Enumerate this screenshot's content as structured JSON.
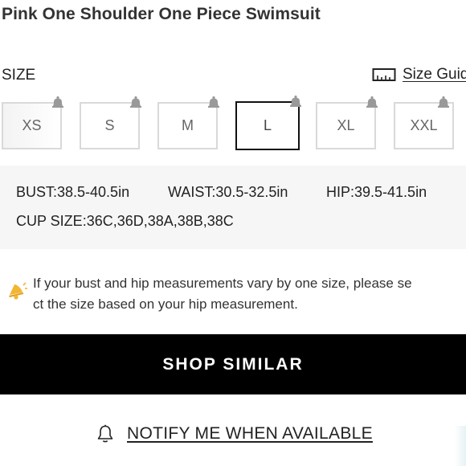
{
  "product": {
    "title": "Pink One Shoulder One Piece Swimsuit"
  },
  "size_section": {
    "label": "SIZE",
    "guide_label": "Size Guide",
    "sizes": [
      {
        "label": "XS",
        "selected": false
      },
      {
        "label": "S",
        "selected": false
      },
      {
        "label": "M",
        "selected": false
      },
      {
        "label": "L",
        "selected": true
      },
      {
        "label": "XL",
        "selected": false
      },
      {
        "label": "XXL",
        "selected": false
      }
    ]
  },
  "measurements": {
    "bust": "BUST:38.5-40.5in",
    "waist": "WAIST:30.5-32.5in",
    "hip": "HIP:39.5-41.5in",
    "cup": "CUP SIZE:36C,36D,38A,38B,38C"
  },
  "tip": {
    "icon": "speaker-bell-icon",
    "line1": "If your bust and hip measurements vary by one size, please se",
    "line2": "ct the size based on your hip measurement."
  },
  "actions": {
    "shop_similar": "SHOP SIMILAR",
    "notify": "NOTIFY ME WHEN AVAILABLE"
  },
  "colors": {
    "button_bg": "#000000",
    "measure_bg": "#f6f6f6",
    "tip_icon": "#f2b632"
  }
}
